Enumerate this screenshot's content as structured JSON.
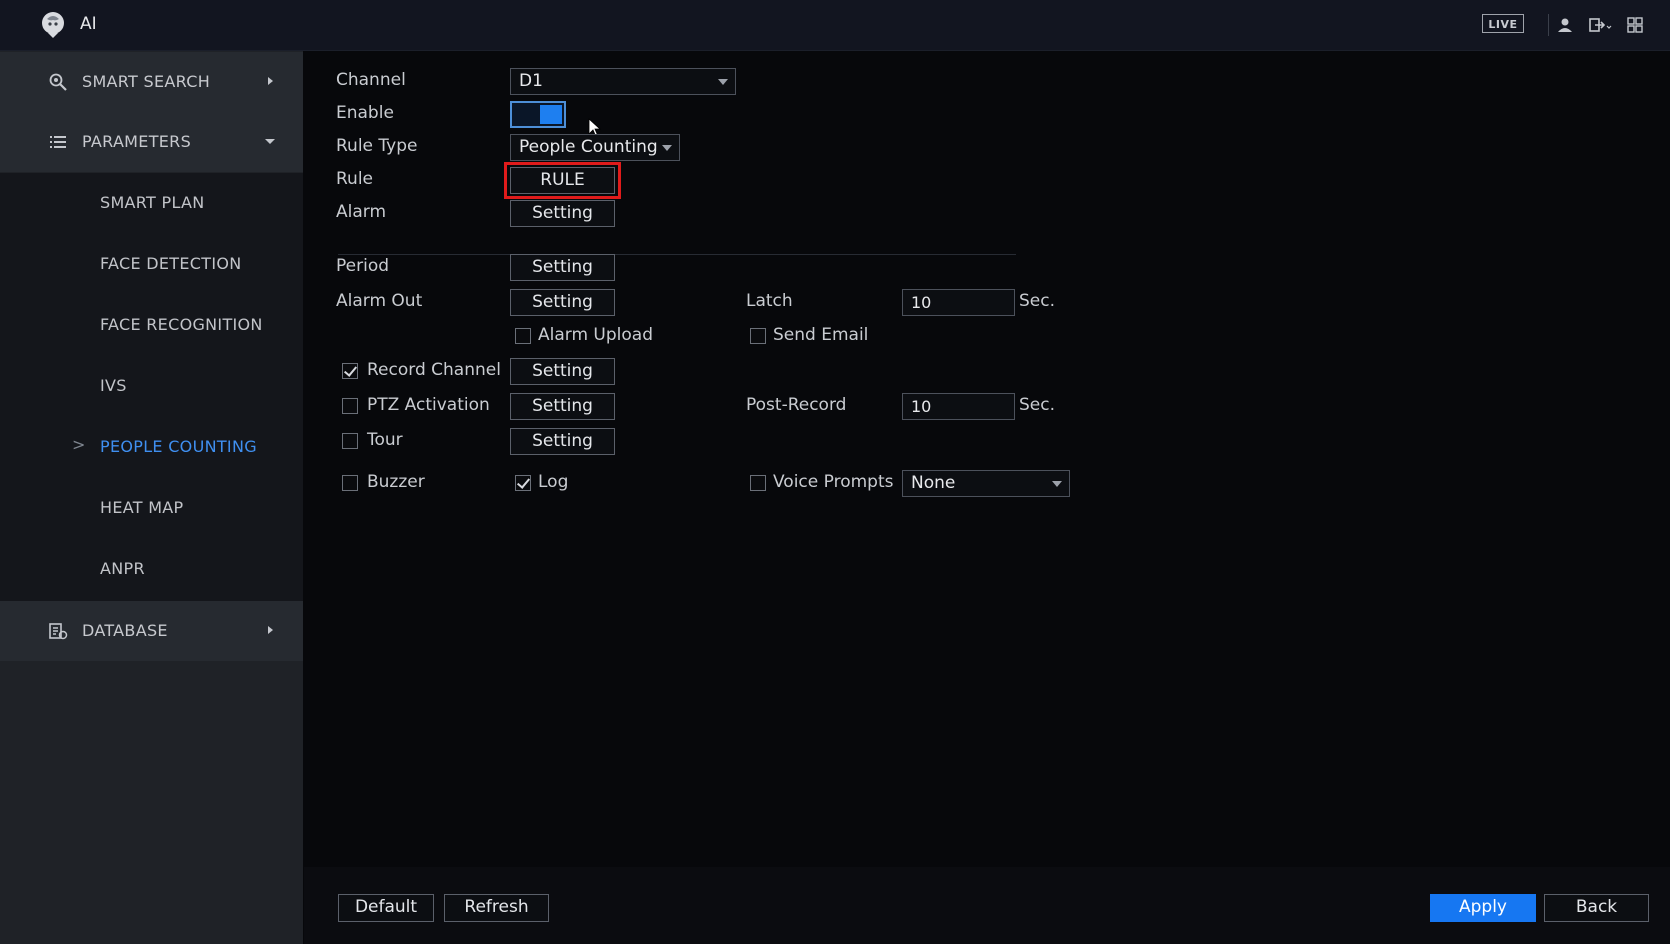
{
  "header": {
    "title": "AI",
    "live_label": "LIVE",
    "icons": [
      "logo-icon",
      "user-icon",
      "logout-icon",
      "grid-icon"
    ]
  },
  "sidebar": {
    "main_items": [
      {
        "label": "SMART SEARCH",
        "icon": "smart-search-icon",
        "arrow": "chevron-right-icon"
      },
      {
        "label": "PARAMETERS",
        "icon": "list-icon",
        "arrow": "chevron-down-icon"
      },
      {
        "label": "DATABASE",
        "icon": "database-icon",
        "arrow": "chevron-right-icon"
      }
    ],
    "sub_items": [
      {
        "label": "SMART PLAN"
      },
      {
        "label": "FACE DETECTION"
      },
      {
        "label": "FACE RECOGNITION"
      },
      {
        "label": "IVS"
      },
      {
        "label": "PEOPLE COUNTING",
        "active": true
      },
      {
        "label": "HEAT MAP"
      },
      {
        "label": "ANPR"
      }
    ],
    "active_caret": ">"
  },
  "form": {
    "channel": {
      "label": "Channel",
      "value": "D1"
    },
    "enable": {
      "label": "Enable",
      "on": true
    },
    "rule_type": {
      "label": "Rule Type",
      "value": "People Counting"
    },
    "rule": {
      "label": "Rule",
      "button": "RULE"
    },
    "alarm": {
      "label": "Alarm",
      "button": "Setting"
    },
    "period": {
      "label": "Period",
      "button": "Setting"
    },
    "alarm_out": {
      "label": "Alarm Out",
      "button": "Setting"
    },
    "latch": {
      "label": "Latch",
      "value": "10",
      "unit": "Sec."
    },
    "alarm_upload": {
      "label": "Alarm Upload",
      "checked": false
    },
    "send_email": {
      "label": "Send Email",
      "checked": false
    },
    "record_channel": {
      "label": "Record Channel",
      "checked": true,
      "button": "Setting"
    },
    "ptz_activation": {
      "label": "PTZ Activation",
      "checked": false,
      "button": "Setting"
    },
    "post_record": {
      "label": "Post-Record",
      "value": "10",
      "unit": "Sec."
    },
    "tour": {
      "label": "Tour",
      "checked": false,
      "button": "Setting"
    },
    "buzzer": {
      "label": "Buzzer",
      "checked": false
    },
    "log": {
      "label": "Log",
      "checked": true
    },
    "voice_prompts": {
      "label": "Voice Prompts",
      "checked": false,
      "value": "None"
    }
  },
  "footer": {
    "default_label": "Default",
    "refresh_label": "Refresh",
    "apply_label": "Apply",
    "back_label": "Back"
  },
  "colors": {
    "accent": "#1677f2",
    "highlight": "#e01b1b",
    "active_text": "#3f8ff0"
  }
}
